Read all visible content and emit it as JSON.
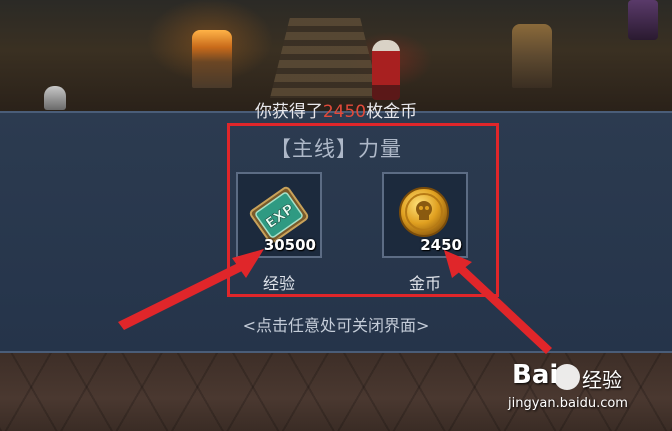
{
  "notice": {
    "prefix": "你获得了",
    "amount": "2450",
    "suffix": "枚金币"
  },
  "quest_title": "【主线】力量",
  "rewards": [
    {
      "icon": "exp-card-icon",
      "count": "30500",
      "label": "经验"
    },
    {
      "icon": "gold-coin-icon",
      "count": "2450",
      "label": "金币"
    }
  ],
  "close_hint": "<点击任意处可关闭界面>",
  "watermark": {
    "brand": "Bai",
    "suffix": "经验",
    "url": "jingyan.baidu.com"
  },
  "colors": {
    "panel": "#25344a",
    "highlight": "#e0262a",
    "amount": "#e24a3a"
  }
}
